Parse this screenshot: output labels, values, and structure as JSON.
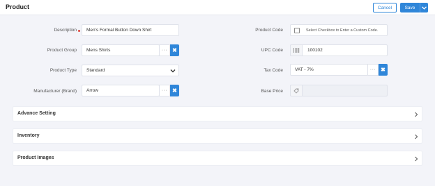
{
  "header": {
    "title": "Product",
    "cancel_label": "Cancel",
    "save_label": "Save"
  },
  "form": {
    "description": {
      "label": "Description",
      "value": "Men's Formal Button Down Shirt",
      "required": true
    },
    "product_group": {
      "label": "Product Group",
      "value": "Mens Shirts",
      "more": "···",
      "clear": "✖"
    },
    "product_type": {
      "label": "Product Type",
      "value": "Standard"
    },
    "manufacturer": {
      "label": "Manufacturer (Brand)",
      "value": "Arrow",
      "more": "···",
      "clear": "✖"
    },
    "product_code": {
      "label": "Product Code",
      "checkbox_text": "Select Checkbox to Enter a Custom Code."
    },
    "upc_code": {
      "label": "UPC Code",
      "value": "100102"
    },
    "tax_code": {
      "label": "Tax Code",
      "value": "VAT - 7%",
      "more": "···",
      "clear": "✖"
    },
    "base_price": {
      "label": "Base Price",
      "value": ""
    }
  },
  "panels": [
    {
      "title": "Advance Setting"
    },
    {
      "title": "Inventory"
    },
    {
      "title": "Product Images"
    }
  ],
  "colors": {
    "accent": "#2f86d9",
    "required": "#e0433b",
    "background": "#f3f4f9"
  },
  "icons": {
    "barcode": "barcode-icon",
    "tag": "tag-icon",
    "chevron": "chevron-right-icon",
    "dropdown": "chevron-down-icon"
  }
}
